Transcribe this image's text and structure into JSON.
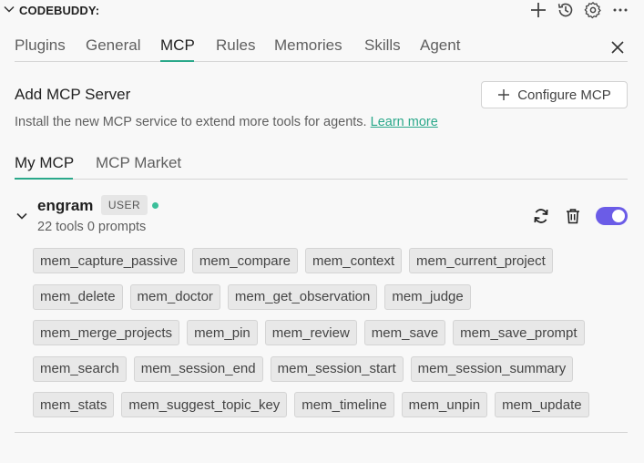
{
  "header": {
    "title": "CODEBUDDY:",
    "icons": [
      "chevron-down-icon",
      "plus-icon",
      "history-icon",
      "gear-icon",
      "more-icon"
    ]
  },
  "tabs": [
    {
      "label": "Plugins",
      "active": false
    },
    {
      "label": "General",
      "active": false
    },
    {
      "label": "MCP",
      "active": true
    },
    {
      "label": "Rules",
      "active": false
    },
    {
      "label": "Memories",
      "active": false
    },
    {
      "label": "Skills",
      "active": false
    },
    {
      "label": "Agent",
      "active": false
    }
  ],
  "add_server": {
    "title": "Add MCP Server",
    "configure_label": "Configure MCP",
    "description": "Install the new MCP service to extend more tools for agents.",
    "learn_more": "Learn more"
  },
  "subtabs": [
    {
      "label": "My MCP",
      "active": true
    },
    {
      "label": "MCP Market",
      "active": false
    }
  ],
  "server": {
    "name": "engram",
    "badge": "USER",
    "status_color": "#3bbf9a",
    "meta": "22 tools 0 prompts",
    "enabled": true,
    "tools": [
      [
        "mem_capture_passive",
        "mem_compare",
        "mem_context",
        "mem_current_project"
      ],
      [
        "mem_delete",
        "mem_doctor",
        "mem_get_observation",
        "mem_judge"
      ],
      [
        "mem_merge_projects",
        "mem_pin",
        "mem_review",
        "mem_save",
        "mem_save_prompt"
      ],
      [
        "mem_search",
        "mem_session_end",
        "mem_session_start",
        "mem_session_summary"
      ],
      [
        "mem_stats",
        "mem_suggest_topic_key",
        "mem_timeline",
        "mem_unpin",
        "mem_update"
      ]
    ]
  },
  "colors": {
    "accent": "#2aa88a",
    "toggle": "#6b5ce7",
    "background": "#f8f8f8"
  }
}
